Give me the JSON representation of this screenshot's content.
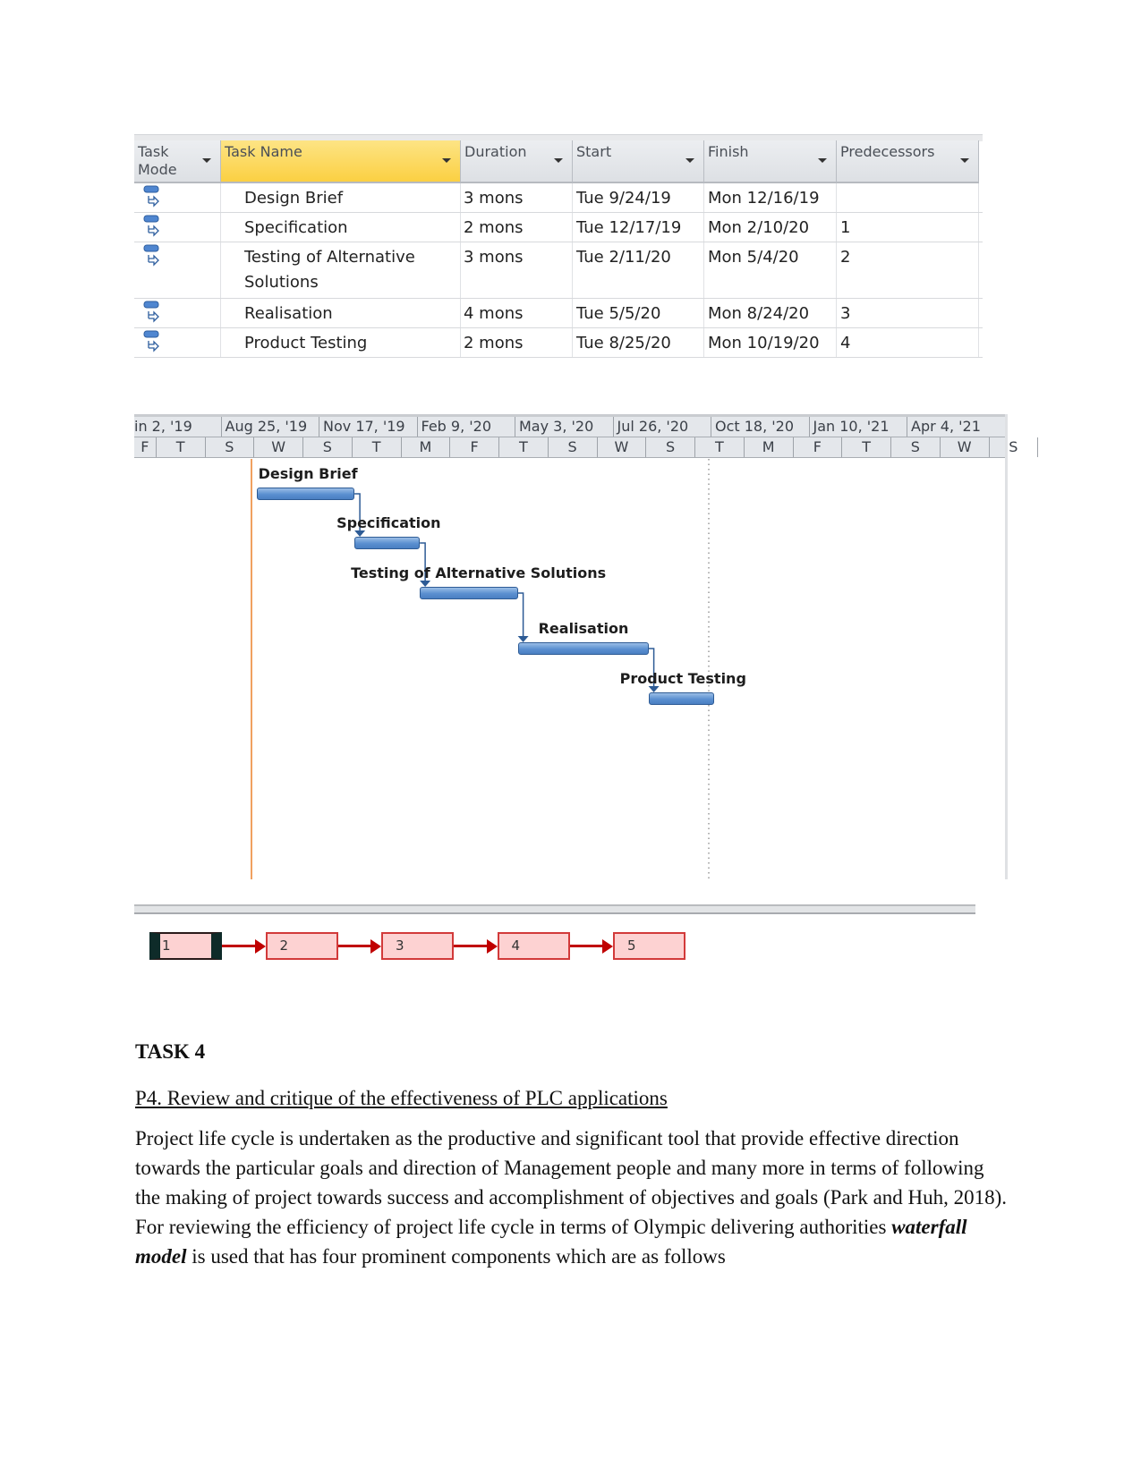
{
  "task_table": {
    "columns": [
      {
        "label": "Task Mode"
      },
      {
        "label": "Task Name"
      },
      {
        "label": "Duration"
      },
      {
        "label": "Start"
      },
      {
        "label": "Finish"
      },
      {
        "label": "Predecessors"
      }
    ],
    "rows": [
      {
        "mode_icon": "auto-scheduled-task-icon",
        "name": "Design Brief",
        "duration": "3 mons",
        "start": "Tue 9/24/19",
        "finish": "Mon 12/16/19",
        "predecessors": ""
      },
      {
        "mode_icon": "auto-scheduled-task-icon",
        "name": "Specification",
        "duration": "2 mons",
        "start": "Tue 12/17/19",
        "finish": "Mon 2/10/20",
        "predecessors": "1"
      },
      {
        "mode_icon": "auto-scheduled-task-icon",
        "name": "Testing of Alternative Solutions",
        "duration": "3 mons",
        "start": "Tue 2/11/20",
        "finish": "Mon 5/4/20",
        "predecessors": "2"
      },
      {
        "mode_icon": "auto-scheduled-task-icon",
        "name": "Realisation",
        "duration": "4 mons",
        "start": "Tue 5/5/20",
        "finish": "Mon 8/24/20",
        "predecessors": "3"
      },
      {
        "mode_icon": "auto-scheduled-task-icon",
        "name": "Product Testing",
        "duration": "2 mons",
        "start": "Tue 8/25/20",
        "finish": "Mon 10/19/20",
        "predecessors": "4"
      }
    ]
  },
  "gantt": {
    "major_ticks": [
      "in 2, '19",
      "Aug 25, '19",
      "Nov 17, '19",
      "Feb 9, '20",
      "May 3, '20",
      "Jul 26, '20",
      "Oct 18, '20",
      "Jan 10, '21",
      "Apr 4, '21"
    ],
    "minor_ticks": [
      "F",
      "T",
      "S",
      "W",
      "S",
      "T",
      "M",
      "F",
      "T",
      "S",
      "W",
      "S",
      "T",
      "M",
      "F",
      "T",
      "S",
      "W",
      "S"
    ],
    "bar_labels": [
      "Design Brief",
      "Specification",
      "Testing of Alternative Solutions",
      "Realisation",
      "Product Testing"
    ],
    "colors": {
      "bar": "#5a8fd0",
      "today_line": "#f0a060",
      "link": "#2d5b95"
    }
  },
  "network": {
    "nodes": [
      "1",
      "2",
      "3",
      "4",
      "5"
    ],
    "selected_node": "1",
    "colors": {
      "node_fill": "#fdd2d2",
      "node_border": "#d23a3a",
      "link": "#c00000"
    }
  },
  "document": {
    "heading": "TASK 4",
    "section_title": "P4. Review and critique of the effectiveness of PLC applications",
    "paragraph": {
      "before": "Project life cycle is undertaken as the productive and significant tool that provide effective direction towards the particular goals and direction of Management people and many more in terms of following the making of project towards success and accomplishment of objectives and goals (Park and Huh, 2018). For reviewing the efficiency of project life cycle in terms of Olympic delivering authorities ",
      "emphasis": "waterfall model",
      "after": " is used that has four prominent components which are as follows"
    }
  }
}
